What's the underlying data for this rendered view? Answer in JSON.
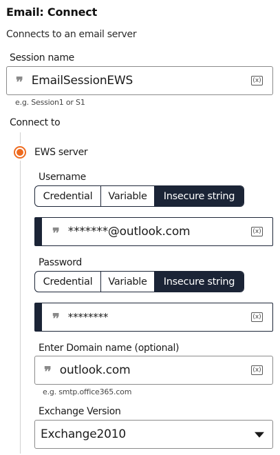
{
  "header": {
    "title": "Email: Connect",
    "subtitle": "Connects to an email server"
  },
  "session": {
    "label": "Session name",
    "value": "EmailSessionEWS",
    "hint": "e.g. Session1 or S1"
  },
  "connect_to": {
    "label": "Connect to",
    "option_label": "EWS server",
    "selected": true
  },
  "username": {
    "label": "Username",
    "segments": [
      "Credential",
      "Variable",
      "Insecure string"
    ],
    "selected_segment": "Insecure string",
    "value": "*******@outlook.com"
  },
  "password": {
    "label": "Password",
    "segments": [
      "Credential",
      "Variable",
      "Insecure string"
    ],
    "selected_segment": "Insecure string",
    "value": "********"
  },
  "domain": {
    "label": "Enter Domain name (optional)",
    "value": "outlook.com",
    "hint": "e.g. smtp.office365.com"
  },
  "exchange": {
    "label": "Exchange Version",
    "value": "Exchange2010"
  },
  "variable_icon_text": "(x)",
  "colors": {
    "accent": "#ee6b1f",
    "navy": "#1b2436"
  }
}
